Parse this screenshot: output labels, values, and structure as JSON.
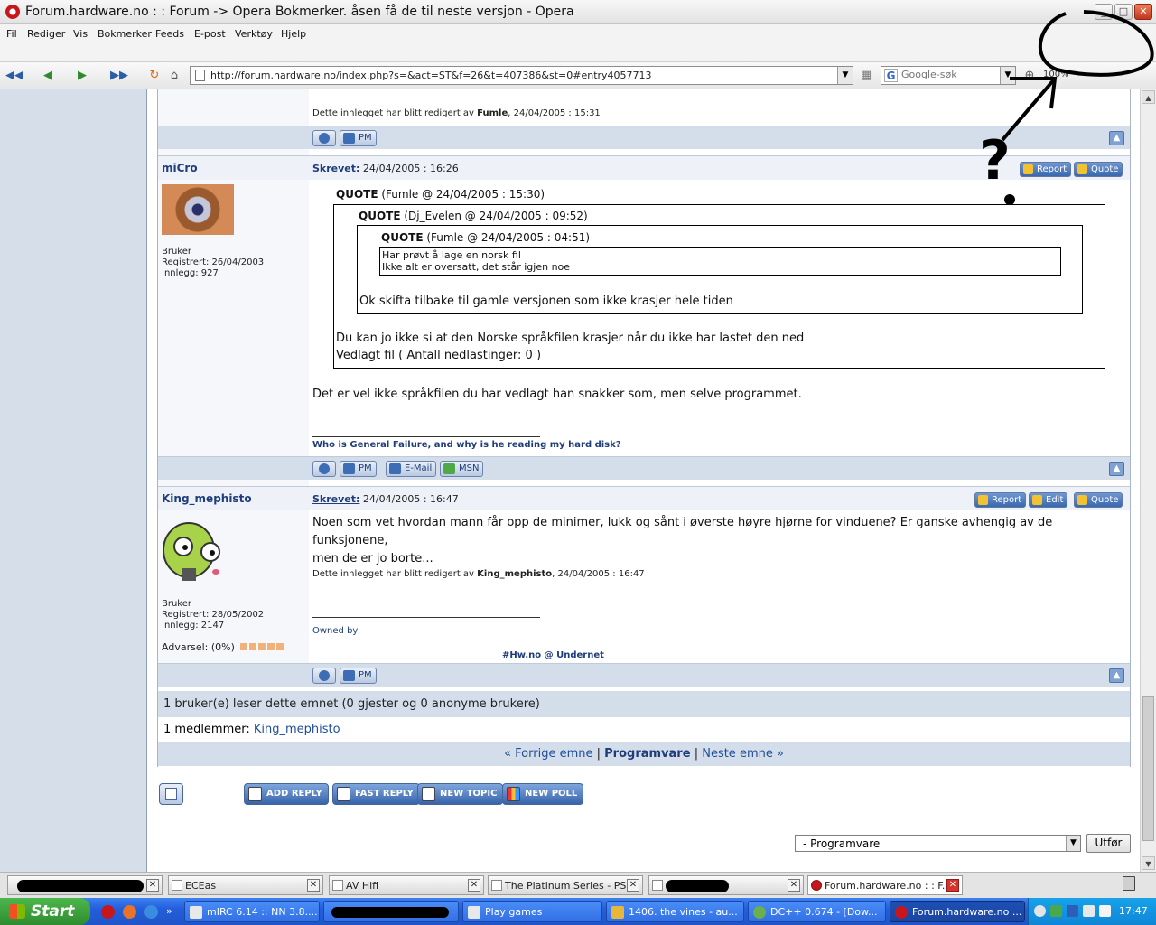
{
  "window": {
    "title": "Forum.hardware.no : : Forum -> Opera Bokmerker. åsen få de til neste versjon - Opera"
  },
  "menu": [
    "Fil",
    "Rediger",
    "Vis",
    "Bokmerker",
    "Feeds",
    "E-post",
    "Verktøy",
    "Hjelp"
  ],
  "address": {
    "url": "http://forum.hardware.no/index.php?s=&act=ST&f=26&t=407386&st=0#entry4057713"
  },
  "search": {
    "placeholder": "Google-søk"
  },
  "zoom": "100%",
  "posts": {
    "prev_edit": {
      "prefix": "Dette innlegget har blitt redigert av ",
      "user": "Fumle",
      "date": ", 24/04/2005 : 15:31"
    },
    "micro": {
      "name": "miCro",
      "written_label": "Skrevet:",
      "date": "24/04/2005 : 16:26",
      "group": "Bruker",
      "registered": "Registrert: 26/04/2003",
      "posts": "Innlegg: 927",
      "quote1_label": "QUOTE",
      "quote1_meta": " (Fumle @ 24/04/2005 : 15:30)",
      "quote2_label": "QUOTE",
      "quote2_meta": " (Dj_Evelen @ 24/04/2005 : 09:52)",
      "quote3_label": "QUOTE",
      "quote3_meta": " (Fumle @ 24/04/2005 : 04:51)",
      "quote3_line1": "Har prøvt å lage en norsk fil",
      "quote3_line2": "Ikke alt er oversatt, det står igjen noe",
      "quote2_text": "Ok skifta tilbake til gamle versjonen som ikke krasjer hele tiden",
      "quote1_text1": "Du kan jo ikke si at den Norske språkfilen krasjer når du ikke har lastet den ned",
      "quote1_text2": "Vedlagt fil ( Antall nedlastinger: 0 )",
      "body": "Det er vel ikke språkfilen du har vedlagt han snakker som, men selve programmet.",
      "signature": "Who is General Failure, and why is he reading my hard disk?"
    },
    "king": {
      "name": "King_mephisto",
      "written_label": "Skrevet:",
      "date": "24/04/2005 : 16:47",
      "group": "Bruker",
      "registered": "Registrert: 28/05/2002",
      "posts": "Innlegg: 2147",
      "warning": "Advarsel: (0%)",
      "body_line1": "Noen som vet hvordan mann får opp de minimer, lukk og sånt i øverste høyre hjørne for vinduene? Er ganske avhengig av de funksjonene,",
      "body_line2": "men de er jo borte...",
      "edit_prefix": "Dette innlegget har blitt redigert av ",
      "edit_user": "King_mephisto",
      "edit_date": ", 24/04/2005 : 16:47",
      "sig1": "Owned by",
      "sig2": "#Hw.no @ Undernet"
    }
  },
  "buttons": {
    "pm": "PM",
    "email": "E-Mail",
    "msn": "MSN",
    "report": "Report",
    "quote": "Quote",
    "edit": "Edit",
    "add_reply": "ADD REPLY",
    "fast_reply": "FAST REPLY",
    "new_topic": "NEW TOPIC",
    "new_poll": "NEW POLL",
    "go": "Utfør"
  },
  "readers": {
    "line1": "1 bruker(e) leser dette emnet (0 gjester og 0 anonyme brukere)",
    "members_label": "1 medlemmer: ",
    "member": "King_mephisto"
  },
  "navigation": {
    "prev": "« Forrige emne",
    "sep": "|",
    "forum": "Programvare",
    "next": "Neste emne »"
  },
  "forum_select": "- Programvare",
  "annotation": "?",
  "tabs": [
    {
      "label": "ECEas"
    },
    {
      "label": "AV Hifi"
    },
    {
      "label": "The Platinum Series - PS..."
    },
    {
      "label": "Forum.hardware.no : : F..."
    }
  ],
  "taskbar": {
    "start": "Start",
    "items": [
      {
        "label": "mIRC 6.14 :: NN 3.8...."
      },
      {
        "label": "Play games"
      },
      {
        "label": "1406. the vines - au..."
      },
      {
        "label": "DC++ 0.674 - [Dow..."
      },
      {
        "label": "Forum.hardware.no ..."
      }
    ],
    "clock": "17:47"
  },
  "colors": {
    "link": "#1f3d7a",
    "row_bar": "#d4deeb",
    "taskbar": "#245edb"
  }
}
